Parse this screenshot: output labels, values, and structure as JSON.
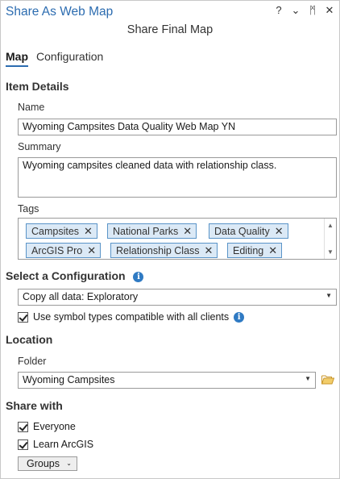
{
  "window": {
    "title": "Share As Web Map",
    "controls": [
      "?",
      "⌄",
      "ᛗ",
      "✕"
    ]
  },
  "subtitle": "Share Final Map",
  "tabs": [
    {
      "label": "Map",
      "active": true
    },
    {
      "label": "Configuration",
      "active": false
    }
  ],
  "item_details": {
    "heading": "Item Details",
    "name_label": "Name",
    "name_value": "Wyoming Campsites Data Quality Web Map YN",
    "summary_label": "Summary",
    "summary_value": "Wyoming campsites cleaned data with relationship class.",
    "tags_label": "Tags",
    "tags": [
      "Campsites",
      "National Parks",
      "Data Quality",
      "ArcGIS Pro",
      "Relationship Class",
      "Editing"
    ]
  },
  "configuration": {
    "heading": "Select a Configuration",
    "selected": "Copy all data: Exploratory",
    "symbol_checkbox_label": "Use symbol types compatible with all clients",
    "symbol_checkbox_checked": true
  },
  "location": {
    "heading": "Location",
    "folder_label": "Folder",
    "folder_value": "Wyoming Campsites"
  },
  "share_with": {
    "heading": "Share with",
    "everyone_label": "Everyone",
    "everyone_checked": true,
    "org_label": "Learn ArcGIS",
    "org_checked": true,
    "groups_label": "Groups"
  },
  "colors": {
    "accent": "#2c6cb0",
    "tag_bg": "#dbe9f6",
    "tag_border": "#5a94c8",
    "folder": "#e8b84a"
  },
  "icons": {
    "info": "info-icon",
    "folder": "folder-icon",
    "tag_remove": "close-icon"
  }
}
